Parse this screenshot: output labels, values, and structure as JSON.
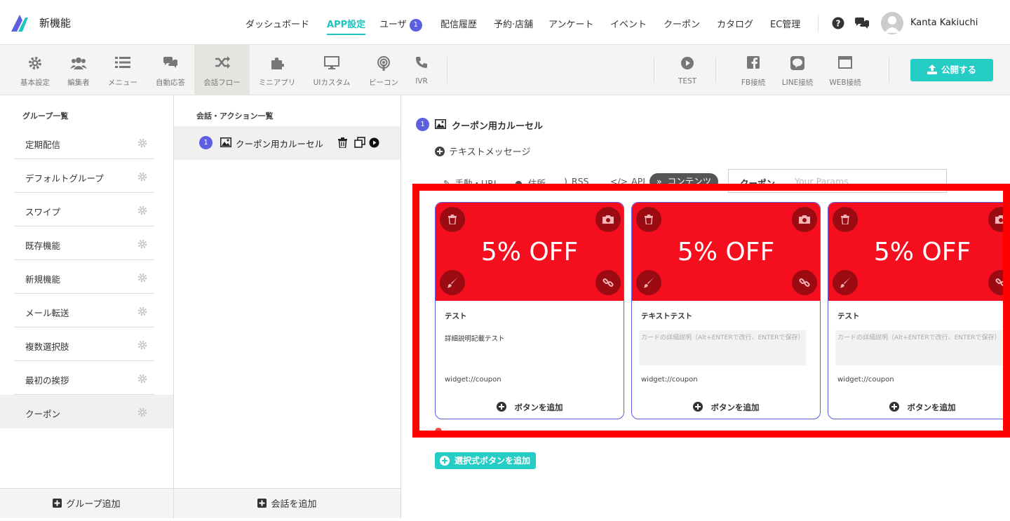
{
  "app": {
    "name": "新機能"
  },
  "nav": {
    "items": [
      "ダッシュボード",
      "APP設定",
      "ユーザ",
      "配信履歴",
      "予約·店舗",
      "アンケート",
      "イベント",
      "クーポン",
      "カタログ",
      "EC管理"
    ],
    "active": "APP設定",
    "user_badge": "1",
    "username": "Kanta Kakiuchi"
  },
  "toolbar": {
    "left": [
      "基本設定",
      "編集者",
      "メニュー",
      "自動応答",
      "会話フロー",
      "ミニアプリ",
      "UIカスタム",
      "ビーコン",
      "IVR"
    ],
    "active": "会話フロー",
    "right": [
      "TEST",
      "FB接続",
      "LINE接続",
      "WEB接続"
    ],
    "publish": "公開する"
  },
  "groups": {
    "title": "グループ一覧",
    "items": [
      "定期配信",
      "デフォルトグループ",
      "スワイプ",
      "既存機能",
      "新規機能",
      "メール転送",
      "複数選択肢",
      "最初の挨拶",
      "クーポン"
    ],
    "active": "クーポン",
    "add": "グループ追加"
  },
  "conversations": {
    "title": "会話・アクション一覧",
    "items": [
      {
        "num": "1",
        "label": "クーポン用カルーセル"
      }
    ],
    "add": "会話を追加"
  },
  "editor": {
    "num": "1",
    "title": "クーポン用カルーセル",
    "add_text": "テキストメッセージ",
    "tabs": [
      "手動・URL",
      "住所",
      "RSS",
      "API",
      "コンテンツ"
    ],
    "active_tab": "コンテンツ",
    "param_select": "クーポン",
    "param_placeholder": "Your Params",
    "cards": [
      {
        "image_text": "5% OFF",
        "title": "テスト",
        "description": "詳細説明記載テスト",
        "placeholder": "",
        "url": "widget://coupon",
        "button": "ボタンを追加"
      },
      {
        "image_text": "5% OFF",
        "title": "テキストテスト",
        "description": "",
        "placeholder": "カードの詳細説明（Alt+ENTERで改行、ENTERで保存）",
        "url": "widget://coupon",
        "button": "ボタンを追加"
      },
      {
        "image_text": "5% OFF",
        "title": "テスト",
        "description": "",
        "placeholder": "カードの詳細説明（Alt+ENTERで改行、ENTERで保存）",
        "url": "widget://coupon",
        "button": "ボタンを追加"
      }
    ],
    "add_select_button": "選択式ボタンを追加"
  },
  "colors": {
    "accent": "#1ec4bf",
    "badge": "#5b5fe0",
    "card_image": "#f50f1e",
    "highlight": "#ff0000"
  }
}
